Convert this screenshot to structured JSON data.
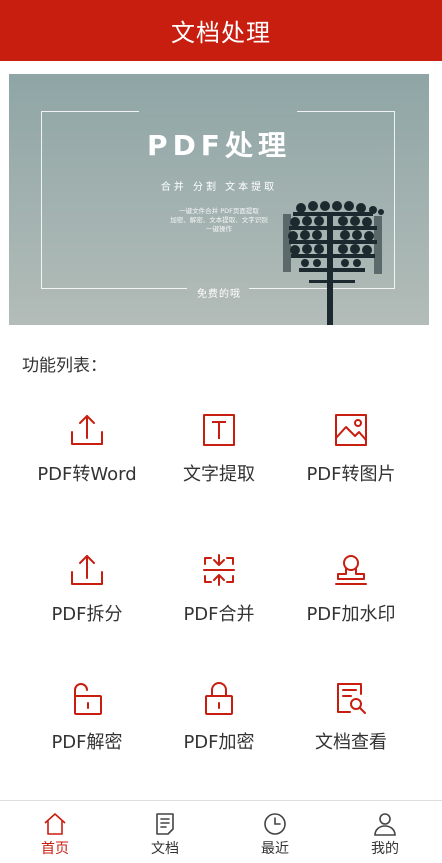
{
  "header": {
    "title": "文档处理"
  },
  "banner": {
    "title": "PDF处理",
    "subtitle": "合并  分割  文本提取",
    "description_line1": "一键文件合并 PDF页面提取",
    "description_line2": "加密、解密、文本提取、文字识别",
    "description_line3": "一键操作",
    "free_label": "免费的哦"
  },
  "section": {
    "title": "功能列表："
  },
  "features": [
    {
      "label": "PDF转Word",
      "icon": "upload-icon"
    },
    {
      "label": "文字提取",
      "icon": "text-t-icon"
    },
    {
      "label": "PDF转图片",
      "icon": "image-icon"
    },
    {
      "label": "PDF拆分",
      "icon": "upload-icon"
    },
    {
      "label": "PDF合并",
      "icon": "merge-icon"
    },
    {
      "label": "PDF加水印",
      "icon": "stamp-icon"
    },
    {
      "label": "PDF解密",
      "icon": "unlock-icon"
    },
    {
      "label": "PDF加密",
      "icon": "lock-icon"
    },
    {
      "label": "文档查看",
      "icon": "doc-search-icon"
    }
  ],
  "tabbar": {
    "items": [
      {
        "label": "首页",
        "icon": "home-icon",
        "active": true
      },
      {
        "label": "文档",
        "icon": "document-icon",
        "active": false
      },
      {
        "label": "最近",
        "icon": "clock-icon",
        "active": false
      },
      {
        "label": "我的",
        "icon": "user-icon",
        "active": false
      }
    ]
  },
  "colors": {
    "brand": "#c81e0f",
    "text": "#333333"
  }
}
